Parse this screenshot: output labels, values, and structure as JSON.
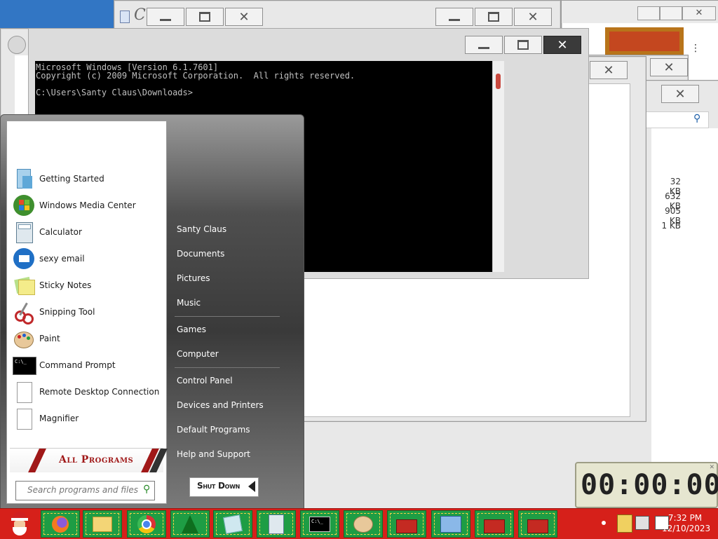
{
  "console": {
    "lines": [
      "Microsoft Windows [Version 6.1.7601]",
      "Copyright (c) 2009 Microsoft Corporation.  All rights reserved.",
      "",
      "C:\\Users\\Santy Claus\\Downloads>"
    ]
  },
  "file_sizes": [
    "32 KB",
    "632 KB",
    "905 KB",
    "1 KB"
  ],
  "start_menu": {
    "programs": [
      {
        "label": "Getting Started",
        "icon": "getting-started-icon"
      },
      {
        "label": "Windows Media Center",
        "icon": "media-center-icon"
      },
      {
        "label": "Calculator",
        "icon": "calculator-icon"
      },
      {
        "label": "sexy email",
        "icon": "thunderbird-icon"
      },
      {
        "label": "Sticky Notes",
        "icon": "sticky-notes-icon"
      },
      {
        "label": "Snipping Tool",
        "icon": "scissors-icon"
      },
      {
        "label": "Paint",
        "icon": "paint-palette-icon"
      },
      {
        "label": "Command Prompt",
        "icon": "cmd-icon"
      },
      {
        "label": "Remote Desktop Connection",
        "icon": "document-icon"
      },
      {
        "label": "Magnifier",
        "icon": "document-icon"
      }
    ],
    "all_programs_label": "All Programs",
    "search_placeholder": "Search programs and files",
    "right_items": [
      "Santy Claus",
      "Documents",
      "Pictures",
      "Music",
      "Games",
      "Computer",
      "Control Panel",
      "Devices and Printers",
      "Default Programs",
      "Help and Support"
    ],
    "shutdown_label": "Shut Down"
  },
  "timer": {
    "display": "00:00:00"
  },
  "taskbar": {
    "buttons": [
      "santa-start-icon",
      "firefox-icon",
      "file-explorer-icon",
      "chrome-icon",
      "christmas-tree-icon",
      "sticky-notes-icon",
      "calculator-icon",
      "cmd-icon",
      "paint-palette-icon",
      "toolbox-icon",
      "control-panel-icon",
      "toolbox-icon",
      "toolbox-icon"
    ],
    "clock_time": "7:32 PM",
    "clock_date": "12/10/2023"
  },
  "colors": {
    "taskbar": "#d6201a",
    "taskbar_button": "#1e9d44",
    "close_red": "#c9483e",
    "all_programs": "#a01818"
  }
}
